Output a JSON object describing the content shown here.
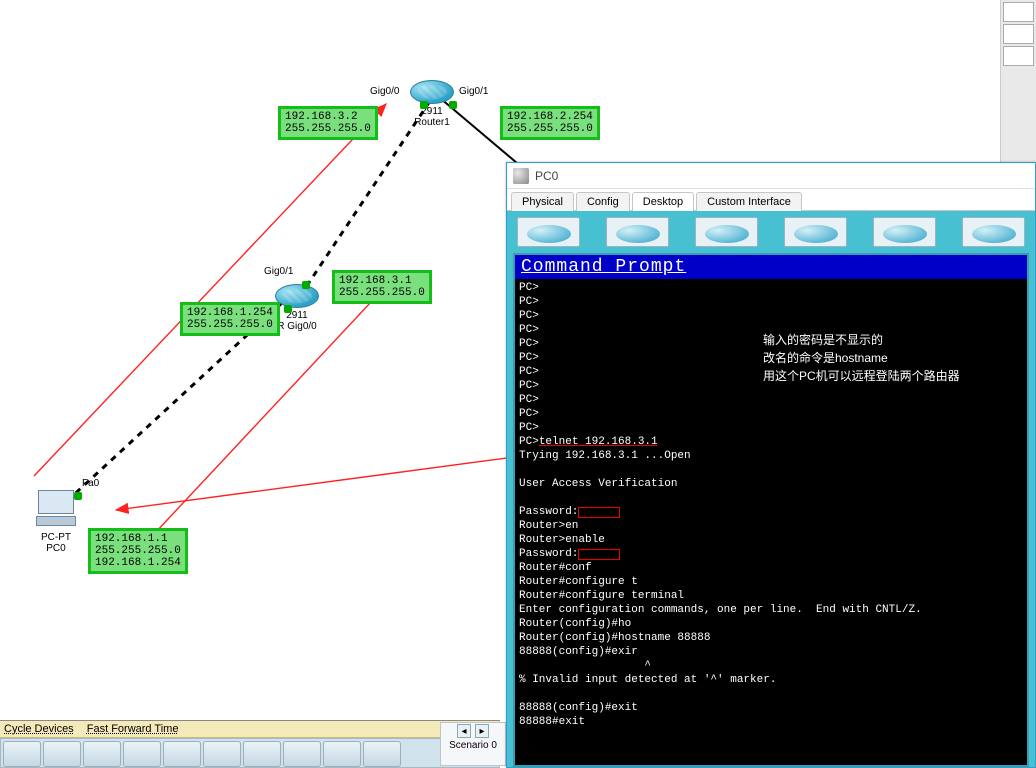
{
  "topology": {
    "router1": {
      "model": "2911",
      "name": "Router1",
      "if_left": "Gig0/0",
      "if_right": "Gig0/1"
    },
    "router2": {
      "model": "2911",
      "name": "R",
      "if_top": "Gig0/1",
      "if_bottom": "Gig0/0"
    },
    "pc0": {
      "type": "PC-PT",
      "name": "PC0",
      "if": "Fa0"
    },
    "notes": {
      "r1_left": {
        "l1": "192.168.3.2",
        "l2": "255.255.255.0"
      },
      "r1_right": {
        "l1": "192.168.2.254",
        "l2": "255.255.255.0"
      },
      "r2_right": {
        "l1": "192.168.3.1",
        "l2": "255.255.255.0"
      },
      "r2_left": {
        "l1": "192.168.1.254",
        "l2": "255.255.255.0"
      },
      "pc": {
        "l1": "192.168.1.1",
        "l2": "255.255.255.0",
        "l3": "192.168.1.254"
      }
    }
  },
  "bottom": {
    "cycle": "Cycle Devices",
    "ffwd": "Fast Forward Time",
    "scenario": "Scenario 0"
  },
  "pcwin": {
    "title": "PC0",
    "tabs": {
      "physical": "Physical",
      "config": "Config",
      "desktop": "Desktop",
      "custom": "Custom Interface"
    },
    "cmd_title": "Command Prompt",
    "annot": {
      "l1": "输入的密码是不显示的",
      "l2": "改名的命令是hostname",
      "l3": "用这个PC机可以远程登陆两个路由器"
    },
    "cmd_lines": {
      "pc": "PC>",
      "telnet_pre": "PC>",
      "telnet_cmd": "telnet 192.168.3.1",
      "trying": "Trying 192.168.3.1 ...Open",
      "uav": "User Access Verification",
      "pwd": "Password:",
      "ren": "Router>en",
      "renable": "Router>enable",
      "rconf": "Router#conf",
      "rconft": "Router#configure t",
      "rconfterm": "Router#configure terminal",
      "enter": "Enter configuration commands, one per line.  End with CNTL/Z.",
      "ho": "Router(config)#ho",
      "hostname": "Router(config)#hostname 88888",
      "exir": "88888(config)#exir",
      "caret": "                   ^",
      "invalid": "% Invalid input detected at '^' marker.",
      "exit1": "88888(config)#exit",
      "exit2": "88888#exit"
    }
  }
}
